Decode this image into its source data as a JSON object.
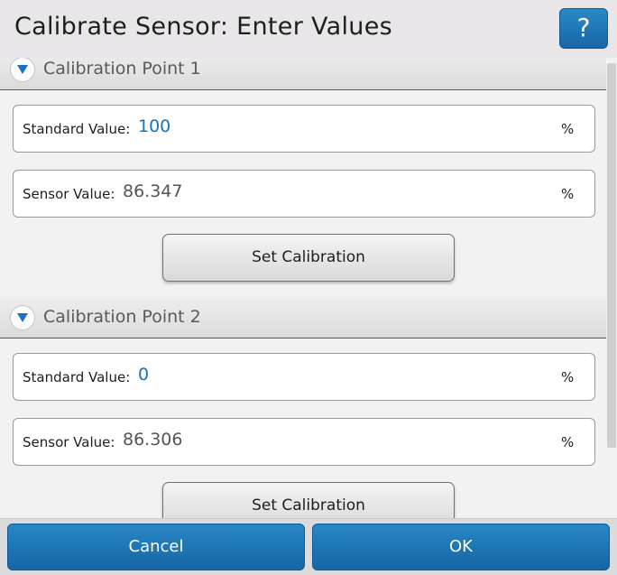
{
  "dialog": {
    "title": "Calibrate Sensor: Enter Values",
    "help_label": "?"
  },
  "sections": [
    {
      "title": "Calibration Point 1",
      "standard_label": "Standard Value:",
      "standard_value": "100",
      "standard_unit": "%",
      "sensor_label": "Sensor Value:",
      "sensor_value": "86.347",
      "sensor_unit": "%",
      "button_label": "Set Calibration"
    },
    {
      "title": "Calibration Point 2",
      "standard_label": "Standard Value:",
      "standard_value": "0",
      "standard_unit": "%",
      "sensor_label": "Sensor Value:",
      "sensor_value": "86.306",
      "sensor_unit": "%",
      "button_label": "Set Calibration"
    }
  ],
  "footer": {
    "cancel_label": "Cancel",
    "ok_label": "OK"
  },
  "colors": {
    "accent": "#1f78b8",
    "value_blue": "#1a72b8"
  }
}
